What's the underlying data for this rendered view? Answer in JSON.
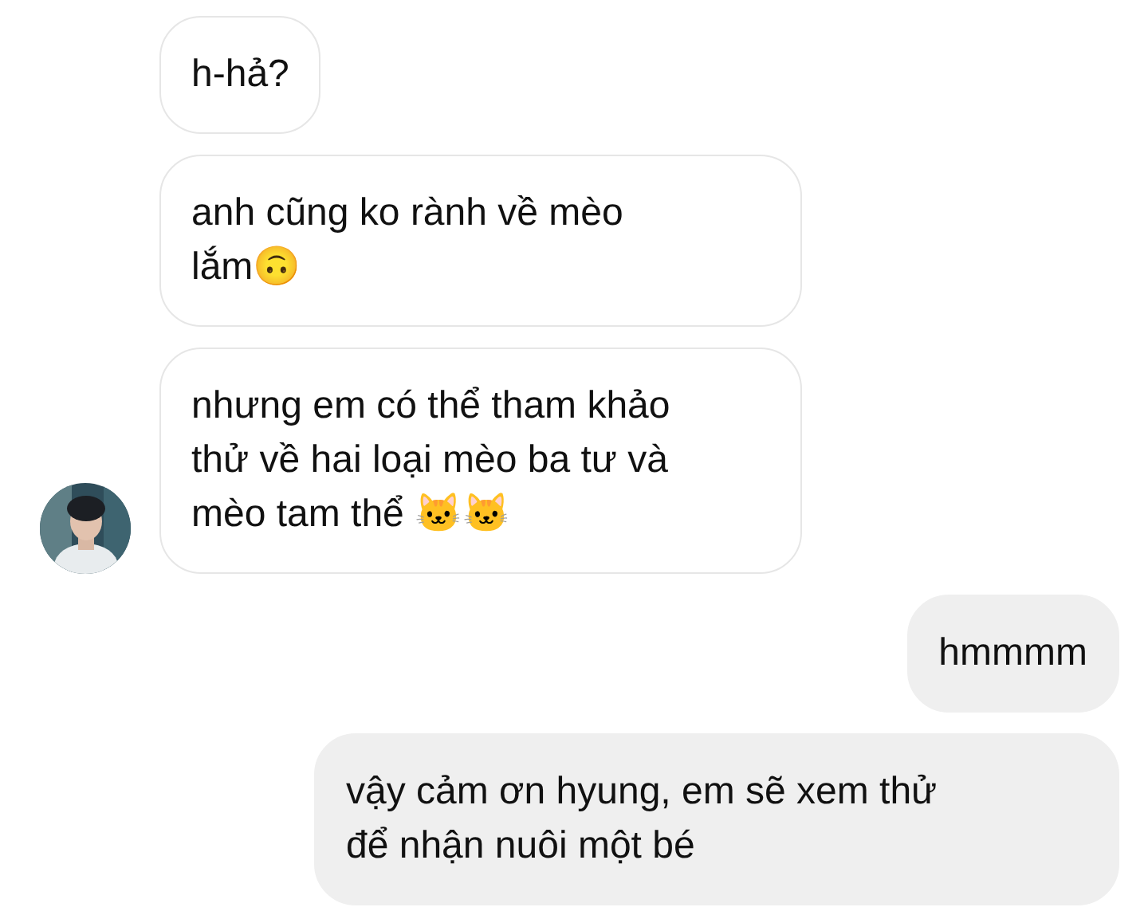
{
  "messages": [
    {
      "kind": "received",
      "show_avatar": false,
      "lines": [
        "h-hả?"
      ]
    },
    {
      "kind": "received",
      "show_avatar": false,
      "lines": [
        "anh cũng ko rành về mèo",
        "lắm🙃"
      ]
    },
    {
      "kind": "received",
      "show_avatar": true,
      "lines": [
        "nhưng em có thể tham khảo",
        "thử về hai loại mèo ba tư và",
        "mèo tam thể 🐱🐱"
      ]
    },
    {
      "kind": "sent",
      "show_avatar": false,
      "lines": [
        "hmmmm"
      ]
    },
    {
      "kind": "sent",
      "show_avatar": false,
      "lines": [
        "vậy cảm ơn hyung, em sẽ xem thử",
        "để nhận nuôi một bé"
      ]
    }
  ]
}
